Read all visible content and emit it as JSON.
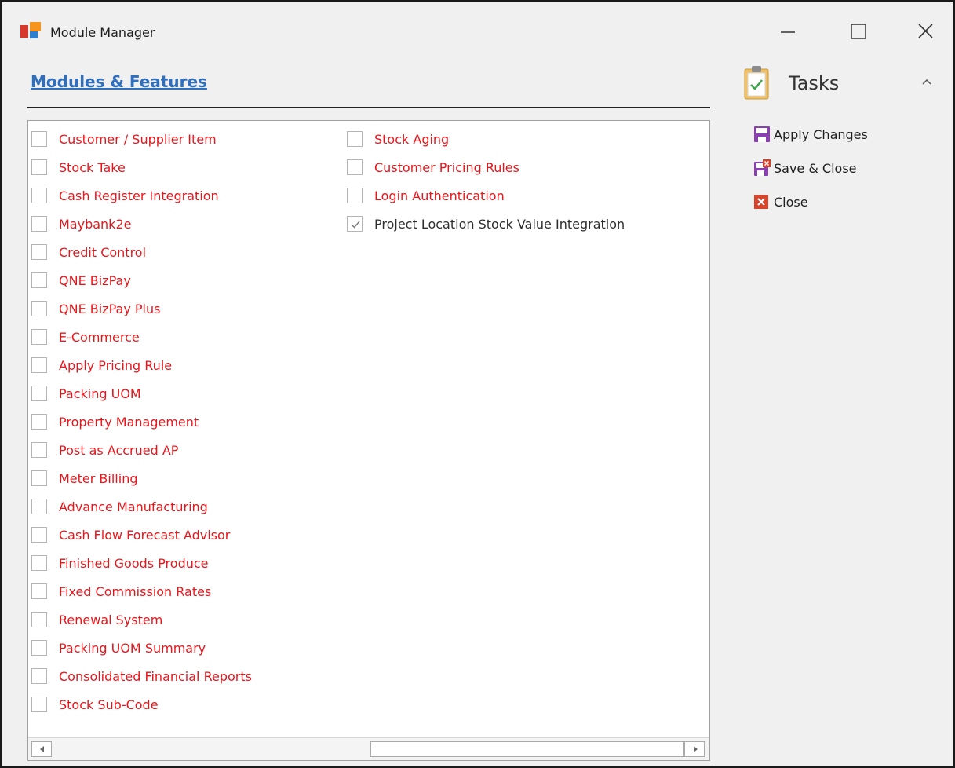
{
  "window": {
    "title": "Module Manager",
    "icon": "module-manager-icon"
  },
  "header": {
    "link_label": "Modules & Features"
  },
  "modules": {
    "column1": [
      {
        "label": "Customer / Supplier Item",
        "checked": false
      },
      {
        "label": "Stock Take",
        "checked": false
      },
      {
        "label": "Cash Register Integration",
        "checked": false
      },
      {
        "label": "Maybank2e",
        "checked": false
      },
      {
        "label": "Credit Control",
        "checked": false
      },
      {
        "label": "QNE BizPay",
        "checked": false
      },
      {
        "label": "QNE BizPay Plus",
        "checked": false
      },
      {
        "label": "E-Commerce",
        "checked": false
      },
      {
        "label": "Apply Pricing Rule",
        "checked": false
      },
      {
        "label": "Packing UOM",
        "checked": false
      },
      {
        "label": "Property Management",
        "checked": false
      },
      {
        "label": "Post as Accrued AP",
        "checked": false
      },
      {
        "label": "Meter Billing",
        "checked": false
      },
      {
        "label": "Advance Manufacturing",
        "checked": false
      },
      {
        "label": "Cash Flow Forecast Advisor",
        "checked": false
      },
      {
        "label": "Finished Goods Produce",
        "checked": false
      },
      {
        "label": "Fixed Commission Rates",
        "checked": false
      },
      {
        "label": "Renewal System",
        "checked": false
      },
      {
        "label": "Packing UOM Summary",
        "checked": false
      },
      {
        "label": "Consolidated Financial Reports",
        "checked": false
      },
      {
        "label": "Stock Sub-Code",
        "checked": false
      }
    ],
    "column2": [
      {
        "label": "Stock Aging",
        "checked": false
      },
      {
        "label": "Customer Pricing Rules",
        "checked": false
      },
      {
        "label": "Login Authentication",
        "checked": false
      },
      {
        "label": "Project Location Stock Value Integration",
        "checked": true
      }
    ]
  },
  "tasks": {
    "title": "Tasks",
    "items": [
      {
        "label": "Apply Changes",
        "icon": "floppy-disk-icon"
      },
      {
        "label": "Save & Close",
        "icon": "save-close-icon"
      },
      {
        "label": "Close",
        "icon": "close-red-icon"
      }
    ]
  },
  "colors": {
    "unchecked_label": "#e8161b",
    "checked_label": "#2d2d2d",
    "link": "#2f6fbe",
    "save_icon": "#8a3fb3",
    "close_icon": "#d9432b"
  }
}
